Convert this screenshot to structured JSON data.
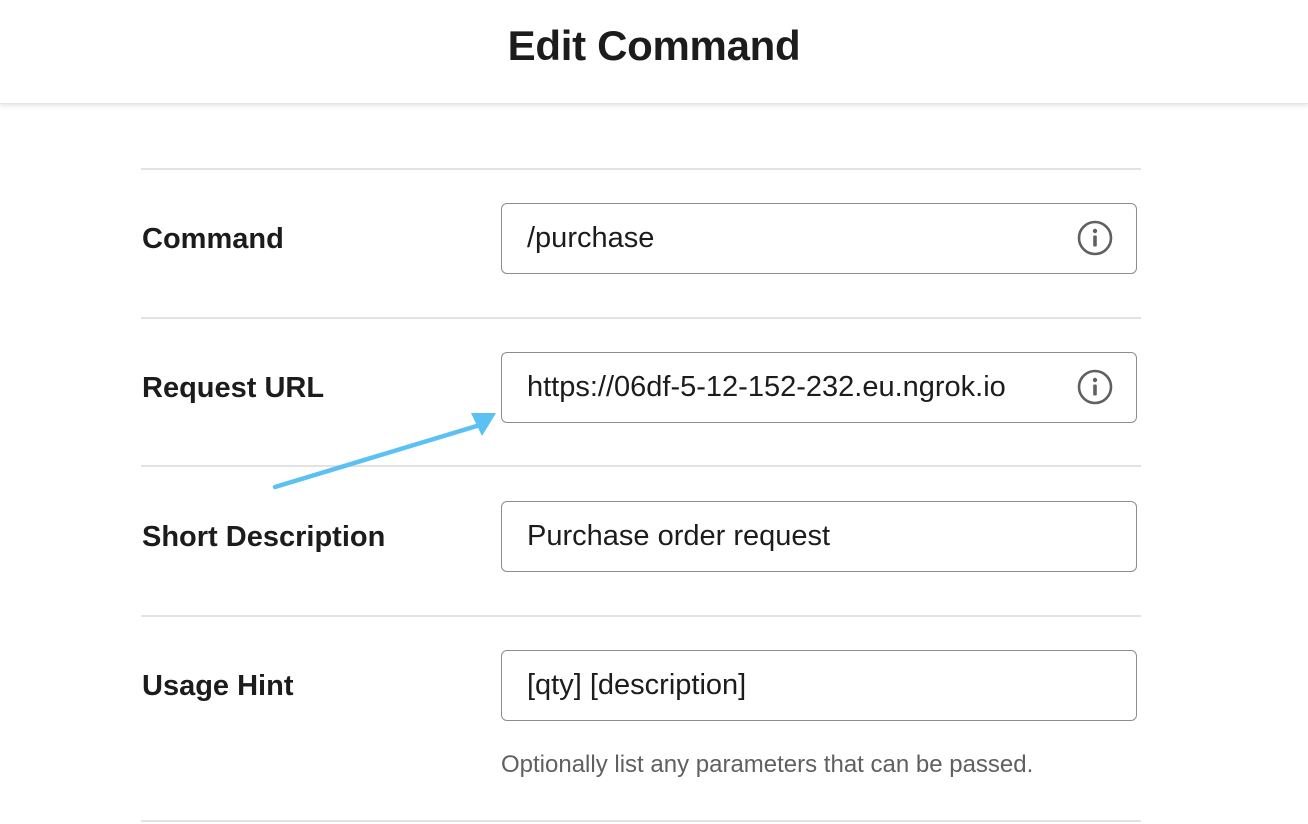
{
  "header": {
    "title": "Edit Command"
  },
  "form": {
    "command": {
      "label": "Command",
      "value": "/purchase",
      "icon": "info-icon"
    },
    "request_url": {
      "label": "Request URL",
      "value": "https://06df-5-12-152-232.eu.ngrok.io",
      "icon": "info-icon"
    },
    "short_description": {
      "label": "Short Description",
      "value": "Purchase order request"
    },
    "usage_hint": {
      "label": "Usage Hint",
      "value": "[qty] [description]",
      "help_text": "Optionally list any parameters that can be passed."
    }
  },
  "annotation": {
    "arrow_color": "#5bc0f2"
  }
}
